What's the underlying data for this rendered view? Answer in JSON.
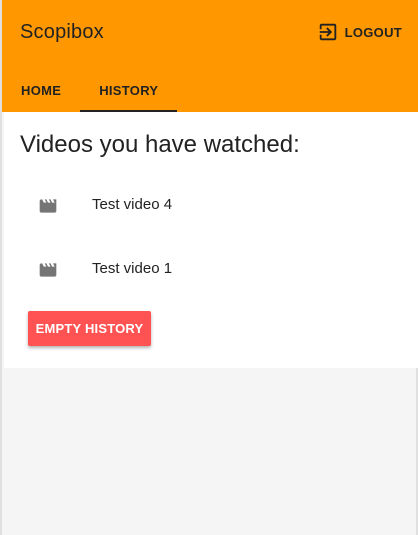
{
  "app": {
    "brand": "Scopibox",
    "logout_label": "LOGOUT",
    "accent_color": "#ff9800",
    "danger_color": "#ff5252"
  },
  "tabs": [
    {
      "label": "HOME",
      "active": false
    },
    {
      "label": "HISTORY",
      "active": true
    }
  ],
  "history": {
    "heading": "Videos you have watched:",
    "items": [
      {
        "title": "Test video 4",
        "icon": "movie-clapper-icon"
      },
      {
        "title": "Test video 1",
        "icon": "movie-clapper-icon"
      }
    ],
    "empty_button_label": "EMPTY HISTORY"
  }
}
